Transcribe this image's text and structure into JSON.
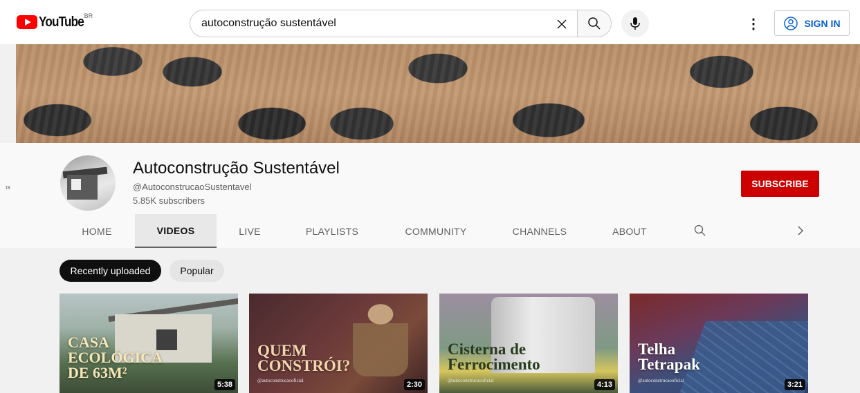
{
  "masthead": {
    "logo_text": "YouTube",
    "country_code": "BR",
    "search_value": "autoconstrução sustentável",
    "signin_label": "SIGN IN",
    "more_label": "⋮"
  },
  "side_stub": "ıs",
  "channel": {
    "title": "Autoconstrução Sustentável",
    "handle": "@AutoconstrucaoSustentavel",
    "subscribers": "5.85K subscribers",
    "subscribe_label": "SUBSCRIBE"
  },
  "tabs": [
    {
      "label": "HOME"
    },
    {
      "label": "VIDEOS"
    },
    {
      "label": "LIVE"
    },
    {
      "label": "PLAYLISTS"
    },
    {
      "label": "COMMUNITY"
    },
    {
      "label": "CHANNELS"
    },
    {
      "label": "ABOUT"
    }
  ],
  "active_tab": "VIDEOS",
  "chips": [
    {
      "label": "Recently uploaded",
      "selected": true
    },
    {
      "label": "Popular",
      "selected": false
    }
  ],
  "videos": [
    {
      "title_line1": "CASA",
      "title_line2": "ECOLÓGICA",
      "title_line3": "DE 63M²",
      "handle": "",
      "duration": "5:38"
    },
    {
      "title_line1": "QUEM",
      "title_line2": "CONSTRÓI?",
      "title_line3": "",
      "handle": "@autoconstrucaooficial",
      "duration": "2:30"
    },
    {
      "title_line1": "Cisterna de",
      "title_line2": "Ferrocimento",
      "title_line3": "",
      "handle": "@autoconstrucaooficial",
      "duration": "4:13"
    },
    {
      "title_line1": "Telha",
      "title_line2": "Tetrapak",
      "title_line3": "",
      "handle": "@autoconstrucaooficial",
      "duration": "3:21"
    }
  ],
  "colors": {
    "brand_red": "#ff0000",
    "subscribe_red": "#cc0000",
    "link_blue": "#065fd4"
  },
  "icons": [
    "youtube-logo-icon",
    "clear-icon",
    "search-icon",
    "mic-icon",
    "more-vert-icon",
    "user-circle-icon",
    "chevron-right-icon"
  ]
}
